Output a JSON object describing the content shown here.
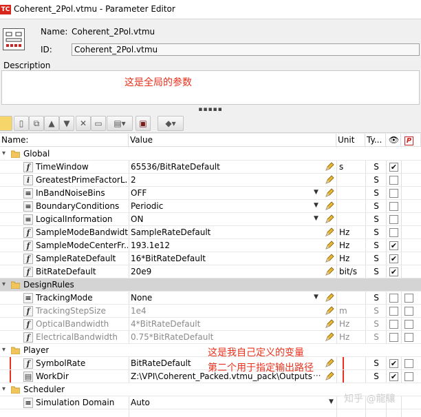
{
  "window": {
    "title": "Coherent_2Pol.vtmu - Parameter Editor",
    "app_icon_text": "TC"
  },
  "header": {
    "name_label": "Name:",
    "name_value": "Coherent_2Pol.vtmu",
    "id_label": "ID:",
    "id_value": "Coherent_2Pol.vtmu"
  },
  "description": {
    "label": "Description",
    "text": "这是全局的参数"
  },
  "splitter": "▪▪▪▪▪",
  "columns": {
    "name": "Name:",
    "value": "Value",
    "unit": "Unit",
    "type": "Ty..."
  },
  "groups": {
    "global": "Global",
    "designrules": "DesignRules",
    "player": "Player",
    "scheduler": "Scheduler"
  },
  "rows": [
    {
      "name": "TimeWindow",
      "value": "65536/BitRateDefault",
      "unit": "s",
      "type": "S",
      "checked": true
    },
    {
      "name": "GreatestPrimeFactorL...",
      "value": "2",
      "unit": "",
      "type": "S",
      "checked": false
    },
    {
      "name": "InBandNoiseBins",
      "value": "OFF",
      "unit": "",
      "type": "S",
      "checked": false
    },
    {
      "name": "BoundaryConditions",
      "value": "Periodic",
      "unit": "",
      "type": "S",
      "checked": false
    },
    {
      "name": "LogicalInformation",
      "value": "ON",
      "unit": "",
      "type": "S",
      "checked": false
    },
    {
      "name": "SampleModeBandwidth",
      "value": "SampleRateDefault",
      "unit": "Hz",
      "type": "S",
      "checked": false
    },
    {
      "name": "SampleModeCenterFr...",
      "value": "193.1e12",
      "unit": "Hz",
      "type": "S",
      "checked": true
    },
    {
      "name": "SampleRateDefault",
      "value": "16*BitRateDefault",
      "unit": "Hz",
      "type": "S",
      "checked": true
    },
    {
      "name": "BitRateDefault",
      "value": "20e9",
      "unit": "bit/s",
      "type": "S",
      "checked": true
    },
    {
      "name": "TrackingMode",
      "value": "None",
      "unit": "",
      "type": "S",
      "checked": false
    },
    {
      "name": "TrackingStepSize",
      "value": "1e4",
      "unit": "m",
      "type": "S",
      "checked": false
    },
    {
      "name": "OpticalBandwidth",
      "value": "4*BitRateDefault",
      "unit": "Hz",
      "type": "S",
      "checked": false
    },
    {
      "name": "ElectricalBandwidth",
      "value": "0.75*BitRateDefault",
      "unit": "Hz",
      "type": "S",
      "checked": false
    },
    {
      "name": "SymbolRate",
      "value": "BitRateDefault",
      "unit": "",
      "type": "S",
      "checked": true
    },
    {
      "name": "WorkDir",
      "value": "Z:\\VPI\\Coherent_Packed.vtmu_pack\\Outputs",
      "unit": "",
      "type": "S",
      "checked": true
    },
    {
      "name": "Simulation Domain",
      "value": "Auto",
      "unit": "",
      "type": "",
      "checked": false
    }
  ],
  "annotations": {
    "line1": "这是我自己定义的变量",
    "line2": "第二个用于指定输出路径"
  },
  "watermark": "知乎 @龍驤",
  "workdir_more": "···"
}
